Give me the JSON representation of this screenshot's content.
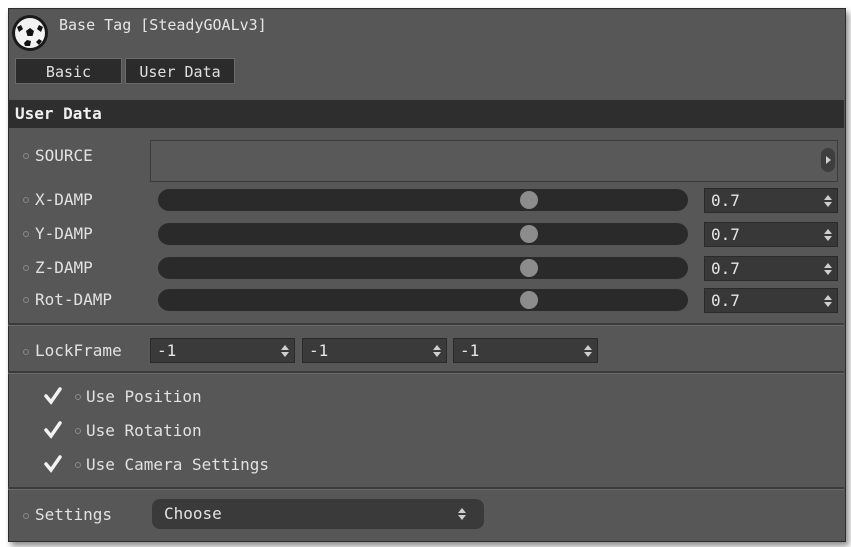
{
  "header": {
    "title": "Base Tag [SteadyGOALv3]",
    "logo_icon": "soccer-ball-icon"
  },
  "tabs": [
    {
      "label": "Basic"
    },
    {
      "label": "User Data"
    }
  ],
  "section": {
    "title": "User Data"
  },
  "source": {
    "label": "SOURCE"
  },
  "damping": [
    {
      "label": "X-DAMP",
      "value": "0.7",
      "slider_fraction": 0.7
    },
    {
      "label": "Y-DAMP",
      "value": "0.7",
      "slider_fraction": 0.7
    },
    {
      "label": "Z-DAMP",
      "value": "0.7",
      "slider_fraction": 0.7
    },
    {
      "label": "Rot-DAMP",
      "value": "0.7",
      "slider_fraction": 0.7
    }
  ],
  "lockframe": {
    "label": "LockFrame",
    "values": [
      "-1",
      "-1",
      "-1"
    ]
  },
  "options": [
    {
      "label": "Use Position",
      "checked": true
    },
    {
      "label": "Use Rotation",
      "checked": true
    },
    {
      "label": "Use Camera Settings",
      "checked": true
    }
  ],
  "settings": {
    "label": "Settings",
    "selected": "Choose"
  },
  "colors": {
    "panel": "#575757",
    "field": "#383838",
    "track": "#2a2a2a",
    "knob": "#8c8c8c",
    "header": "#2e2e2e"
  }
}
